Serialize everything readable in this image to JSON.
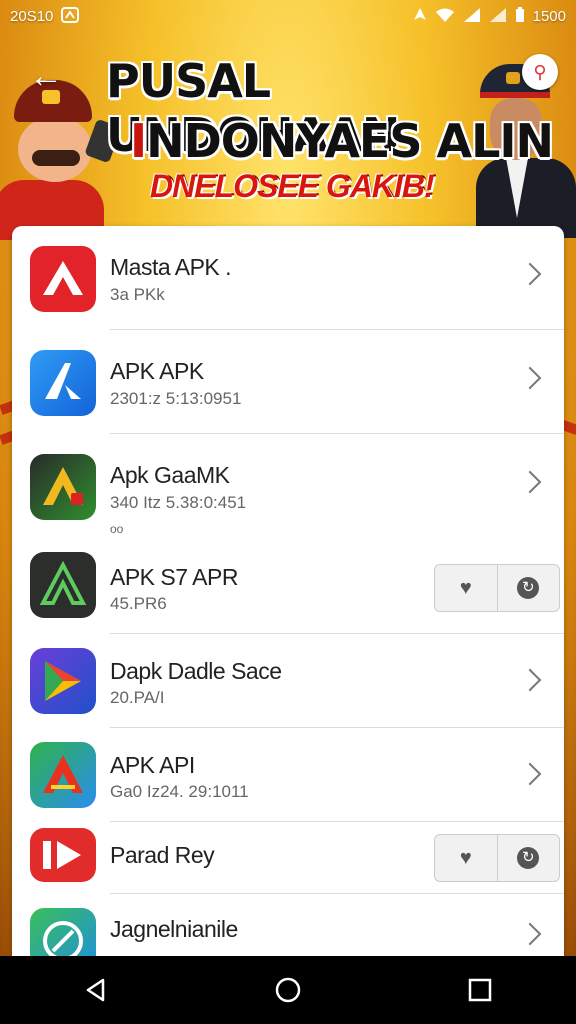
{
  "status_bar": {
    "time": "20S10",
    "battery_text": "1500",
    "icons": [
      "notification-icon",
      "location-icon",
      "wifi-icon",
      "signal-icon",
      "signal-icon",
      "battery-icon"
    ]
  },
  "banner": {
    "title_line1": "PUSAL UNDOHAAN",
    "title_line2_prefix": "I",
    "title_line2": "NDONYAES ALIN",
    "subtitle": "DNELOSEE GAKIB!"
  },
  "apps": [
    {
      "name": "Masta APK .",
      "meta": "3a PKk",
      "icon": "red-a-icon",
      "action": "chevron"
    },
    {
      "name": "APK APK",
      "meta": "2301:z 5:13:0951",
      "icon": "blue-a-icon",
      "action": "chevron"
    },
    {
      "name": "Apk GaaMK",
      "meta": "340 Itz 5.38:0:451",
      "icon": "gaming-a-icon",
      "action": "chevron",
      "extra": "oo"
    },
    {
      "name": "APK S7 APR",
      "meta": "45.PR6",
      "icon": "dark-a-icon",
      "action": "buttons"
    },
    {
      "name": "Dapk Dadle Sace",
      "meta": "20.PA/I",
      "icon": "play-store-icon",
      "action": "chevron"
    },
    {
      "name": "APK API",
      "meta": "Ga0 Iz24. 29:1011",
      "icon": "rainbow-a-icon",
      "action": "chevron"
    },
    {
      "name": "Parad Rey",
      "meta": "",
      "icon": "red-play-icon",
      "action": "buttons"
    },
    {
      "name": "Jagnelnianile",
      "meta": "",
      "icon": "blue-pen-icon",
      "action": "chevron"
    }
  ],
  "colors": {
    "accent_red": "#d8160e",
    "banner_yellow": "#f3b21b"
  }
}
